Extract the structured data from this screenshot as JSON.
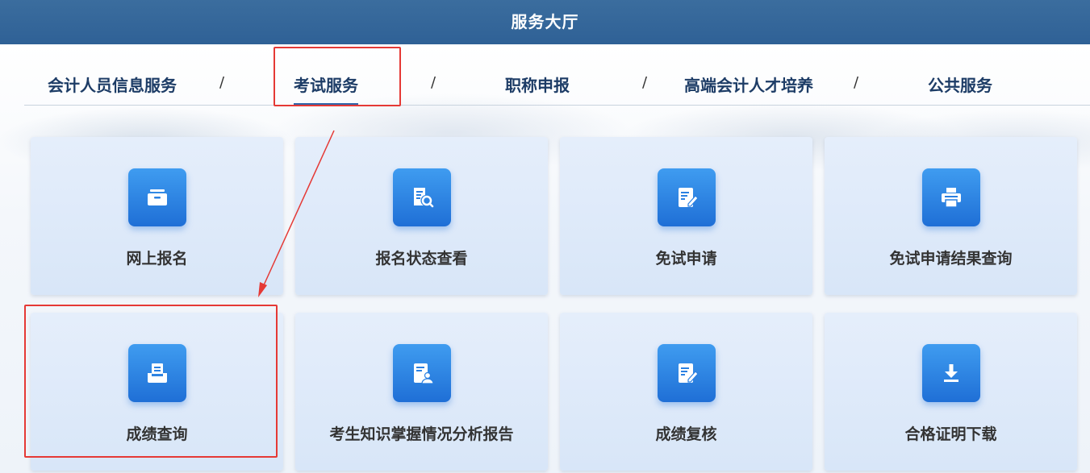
{
  "header": {
    "title": "服务大厅"
  },
  "tabs": [
    {
      "label": "会计人员信息服务"
    },
    {
      "label": "考试服务",
      "active": true
    },
    {
      "label": "职称申报"
    },
    {
      "label": "高端会计人才培养"
    },
    {
      "label": "公共服务"
    }
  ],
  "separator": "/",
  "cards": [
    {
      "label": "网上报名",
      "icon": "inbox-tray-icon"
    },
    {
      "label": "报名状态查看",
      "icon": "document-search-icon"
    },
    {
      "label": "免试申请",
      "icon": "edit-document-icon"
    },
    {
      "label": "免试申请结果查询",
      "icon": "printer-icon"
    },
    {
      "label": "成绩查询",
      "icon": "tray-document-icon"
    },
    {
      "label": "考生知识掌握情况分析报告",
      "icon": "document-user-icon"
    },
    {
      "label": "成绩复核",
      "icon": "edit-document-icon"
    },
    {
      "label": "合格证明下载",
      "icon": "download-icon"
    }
  ],
  "colors": {
    "header_bg": "#2f6196",
    "card_bg": "#dde9f9",
    "icon_bg": "#2a80e2",
    "annotation_red": "#e53935"
  }
}
